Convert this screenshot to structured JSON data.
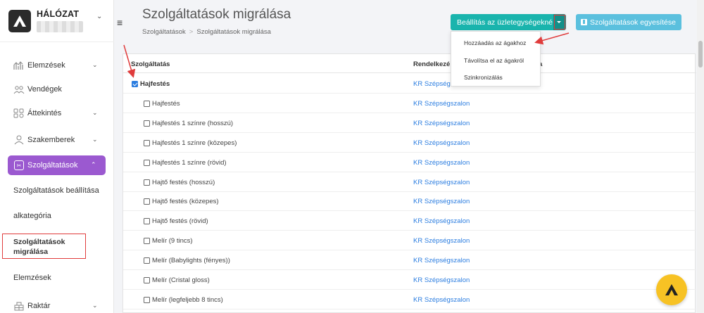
{
  "brand": {
    "name": "HÁLÓZAT"
  },
  "sidebar": {
    "items": [
      {
        "label": "Elemzések",
        "icon": "chart-icon",
        "has_chevron": true
      },
      {
        "label": "Vendégek",
        "icon": "users-icon",
        "has_chevron": false
      },
      {
        "label": "Áttekintés",
        "icon": "grid-icon",
        "has_chevron": true
      },
      {
        "label": "Szakemberek",
        "icon": "person-icon",
        "has_chevron": true
      },
      {
        "label": "Szolgáltatások",
        "icon": "scissors-icon",
        "has_chevron": true,
        "active": true
      },
      {
        "label": "Szolgáltatások beállítása"
      },
      {
        "label": "alkategória"
      },
      {
        "label": "Szolgáltatások migrálása",
        "highlighted": true
      },
      {
        "label": "Elemzések"
      },
      {
        "label": "Raktár",
        "icon": "warehouse-icon",
        "has_chevron": true
      }
    ],
    "active_color": "#9b59d0"
  },
  "header": {
    "title": "Szolgáltatások migrálása",
    "breadcrumb": [
      "Szolgáltatások",
      "Szolgáltatások migrálása"
    ],
    "settings_button": "Beállítás az üzletegységekné",
    "merge_button": "Szolgáltatások egyesítése"
  },
  "dropdown": {
    "options": [
      "Hozzáadás az ágakhoz",
      "Távolítsa el az ágakról",
      "Szinkronizálás"
    ]
  },
  "table": {
    "columns": [
      "Szolgáltatás",
      "Rendelkezé",
      "a"
    ],
    "rows": [
      {
        "name": "Hajfestés",
        "location": "KR Szépségszalon",
        "parent": true,
        "checked": true
      },
      {
        "name": "Hajfestés",
        "location": "KR Szépségszalon",
        "checked": false
      },
      {
        "name": "Hajfestés 1 színre (hosszú)",
        "location": "KR Szépségszalon",
        "checked": false
      },
      {
        "name": "Hajfestés 1 színre (közepes)",
        "location": "KR Szépségszalon",
        "checked": false
      },
      {
        "name": "Hajfestés 1 színre (rövid)",
        "location": "KR Szépségszalon",
        "checked": false
      },
      {
        "name": "Hajtő festés (hosszú)",
        "location": "KR Szépségszalon",
        "checked": false
      },
      {
        "name": "Hajtő festés (közepes)",
        "location": "KR Szépségszalon",
        "checked": false
      },
      {
        "name": "Hajtő festés (rövid)",
        "location": "KR Szépségszalon",
        "checked": false
      },
      {
        "name": "Melír (9 tincs)",
        "location": "KR Szépségszalon",
        "checked": false
      },
      {
        "name": "Melír (Babylights (fényes))",
        "location": "KR Szépségszalon",
        "checked": false
      },
      {
        "name": "Melír (Cristal gloss)",
        "location": "KR Szépségszalon",
        "checked": false
      },
      {
        "name": "Melír (legfeljebb 8 tincs)",
        "location": "KR Szépségszalon",
        "checked": false
      }
    ]
  },
  "colors": {
    "teal": "#19b4ad",
    "light_blue": "#5bc0de",
    "link": "#2b7de0",
    "annotation_red": "#e03c3c",
    "fab": "#f7c224"
  }
}
